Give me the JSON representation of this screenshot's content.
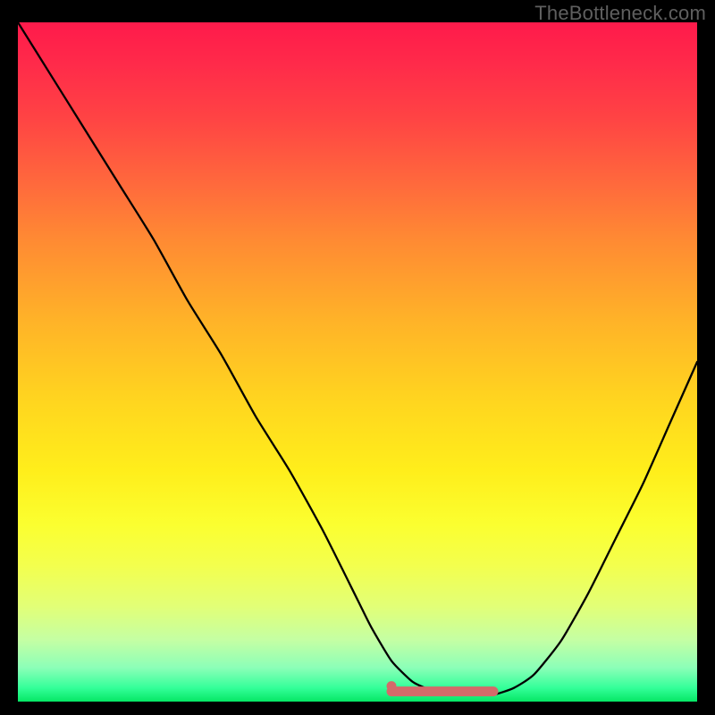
{
  "watermark": "TheBottleneck.com",
  "accent_color": "#d46a6a",
  "curve_color": "#000000",
  "chart_data": {
    "type": "line",
    "title": "",
    "xlabel": "",
    "ylabel": "",
    "xlim": [
      0,
      100
    ],
    "ylim": [
      0,
      100
    ],
    "x": [
      0,
      5,
      10,
      15,
      20,
      25,
      30,
      35,
      40,
      45,
      50,
      52,
      55,
      58,
      60,
      63,
      65,
      68,
      70,
      73,
      76,
      80,
      84,
      88,
      92,
      96,
      100
    ],
    "y": [
      100,
      92,
      84,
      76,
      68,
      59,
      51,
      42,
      34,
      25,
      15,
      11,
      6,
      3,
      2,
      1,
      1,
      1,
      1,
      2,
      4,
      9,
      16,
      24,
      32,
      41,
      50
    ],
    "flat_segment": {
      "x_start": 55,
      "x_end": 70,
      "y": 1.5
    },
    "annotations": []
  }
}
